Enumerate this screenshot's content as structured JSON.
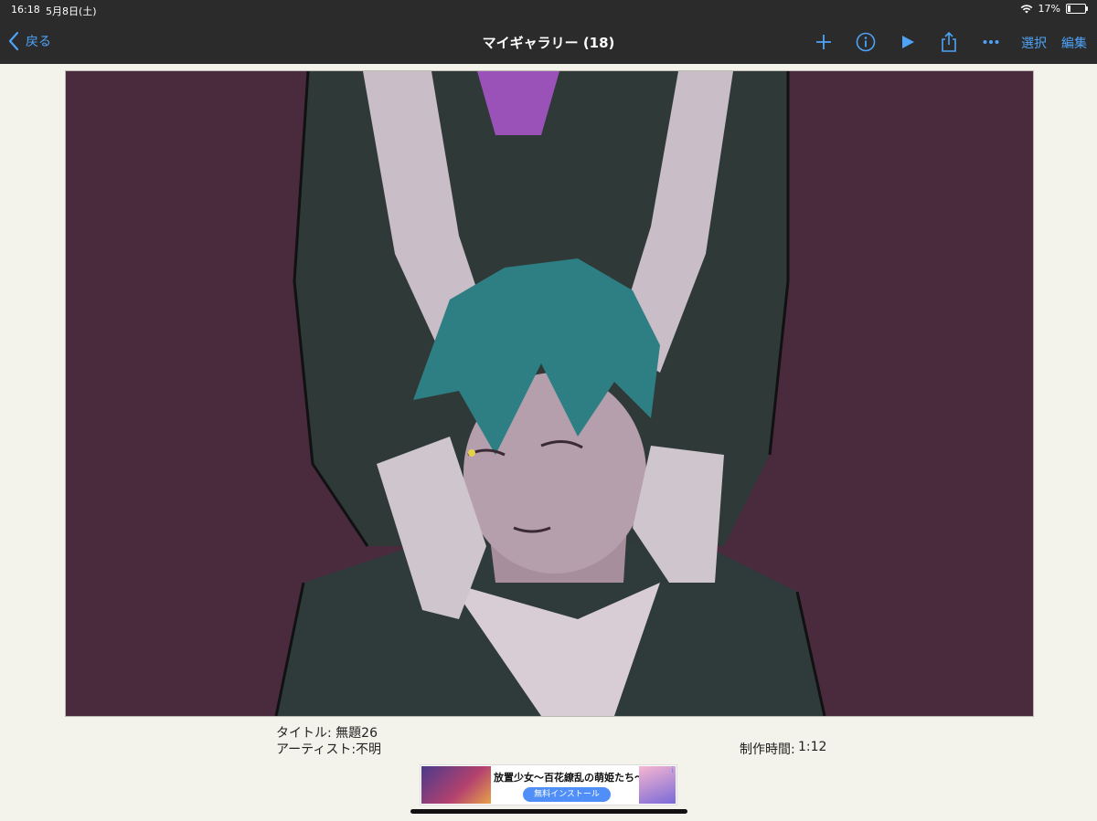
{
  "status": {
    "time": "16:18",
    "date": "5月8日(土)",
    "battery": "17%",
    "battery_level": 0.17
  },
  "nav": {
    "back_label": "戻る",
    "title": "マイギャラリー (18)",
    "select_label": "選択",
    "edit_label": "編集",
    "icons": [
      "back-chevron",
      "plus",
      "info",
      "play",
      "share",
      "more"
    ]
  },
  "artwork": {
    "background_color": "#4a2b3e"
  },
  "meta": {
    "title_line": "タイトル: 無題26",
    "artist_line": "アーティスト:不明",
    "time_label": "制作時間:",
    "time_value": "1:12"
  },
  "ad": {
    "headline": "放置少女～百花繚乱の萌姫たち～",
    "install_label": "無料インストール",
    "info_mark": "i"
  },
  "colors": {
    "accent": "#4ea3f7",
    "bar": "#2b2b2b",
    "page": "#f3f2eb"
  }
}
